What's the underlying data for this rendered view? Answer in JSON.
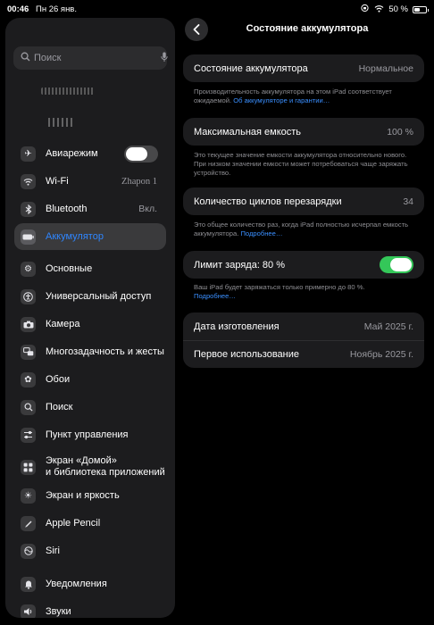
{
  "status_bar": {
    "time": "00:46",
    "date": "Пн 26 янв.",
    "battery": "50 %"
  },
  "sidebar": {
    "search_placeholder": "Поиск",
    "airplane": {
      "label": "Авиарежим"
    },
    "wifi": {
      "label": "Wi-Fi",
      "value": "Zhapon 1"
    },
    "bluetooth": {
      "label": "Bluetooth",
      "value": "Вкл."
    },
    "battery": {
      "label": "Аккумулятор"
    },
    "general": {
      "label": "Основные"
    },
    "accessibility": {
      "label": "Универсальный доступ"
    },
    "camera": {
      "label": "Камера"
    },
    "multitasking": {
      "label": "Многозадачность и жесты"
    },
    "wallpaper": {
      "label": "Обои"
    },
    "search": {
      "label": "Поиск"
    },
    "control_center": {
      "label": "Пункт управления"
    },
    "home_screen": {
      "label_line1": "Экран «Домой»",
      "label_line2": "и библиотека приложений"
    },
    "display": {
      "label": "Экран и яркость"
    },
    "pencil": {
      "label": "Apple Pencil"
    },
    "siri": {
      "label": "Siri"
    },
    "notifications": {
      "label": "Уведомления"
    },
    "sounds": {
      "label": "Звуки"
    }
  },
  "detail": {
    "title": "Состояние аккумулятора",
    "state": {
      "label": "Состояние аккумулятора",
      "value": "Нормальное",
      "note": "Производительность аккумулятора на этом iPad соответствует ожидаемой.",
      "link": "Об аккумуляторе и гарантии…"
    },
    "capacity": {
      "label": "Максимальная емкость",
      "value": "100 %",
      "note": "Это текущее значение емкости аккумулятора относительно нового. При низком значении емкости может потребоваться чаще заряжать устройство."
    },
    "cycles": {
      "label": "Количество циклов перезарядки",
      "value": "34",
      "note": "Это общее количество раз, когда iPad полностью исчерпал емкость аккумулятора.",
      "link": "Подробнее…"
    },
    "limit": {
      "label": "Лимит заряда: 80 %",
      "note": "Ваш iPad будет заряжаться только примерно до 80 %.",
      "link": "Подробнее…"
    },
    "manufacture": {
      "label": "Дата изготовления",
      "value": "Май 2025 г."
    },
    "first_use": {
      "label": "Первое использование",
      "value": "Ноябрь 2025 г."
    }
  }
}
